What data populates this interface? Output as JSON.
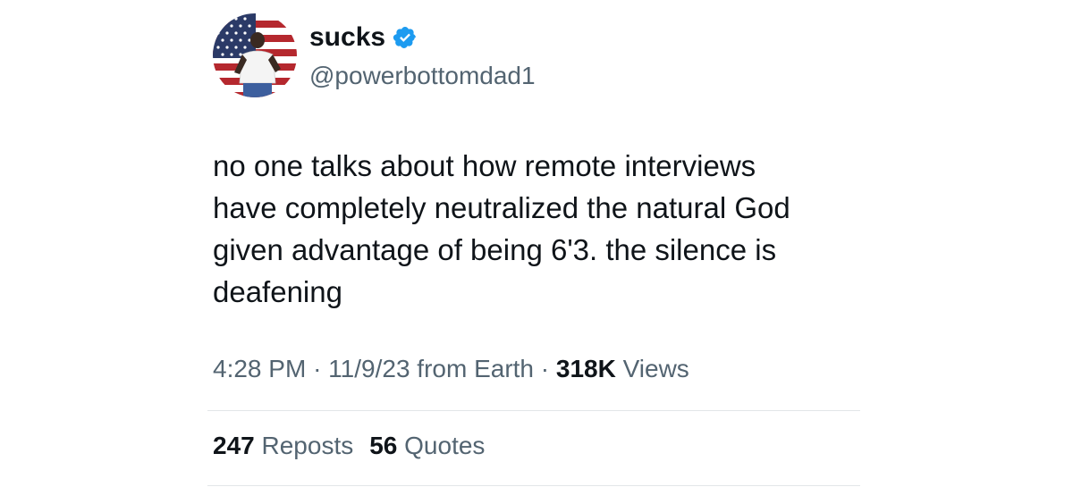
{
  "author": {
    "display_name": "sucks",
    "handle": "@powerbottomdad1",
    "verified": true,
    "avatar_icon": "flag-portrait-avatar"
  },
  "tweet": {
    "text": "no one talks about how remote interviews\nhave completely neutralized the natural God\ngiven advantage of being 6'3. the silence is\ndeafening"
  },
  "meta": {
    "time": "4:28 PM",
    "separator1": "·",
    "date": "11/9/23",
    "source": "from Earth",
    "separator2": "·",
    "views_count": "318K",
    "views_label": "Views"
  },
  "stats": {
    "reposts_count": "247",
    "reposts_label": "Reposts",
    "quotes_count": "56",
    "quotes_label": "Quotes"
  },
  "colors": {
    "text_primary": "#0f1419",
    "text_secondary": "#536471",
    "verified_blue": "#1d9bf0",
    "divider": "#e3e6e8"
  }
}
